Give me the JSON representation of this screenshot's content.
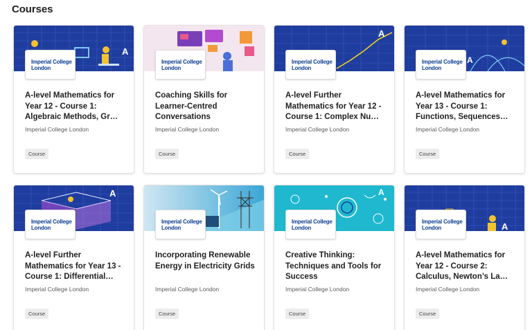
{
  "section": {
    "title": "Courses"
  },
  "courses": [
    {
      "title": "A-level Mathematics for Year 12 - Course 1: Algebraic Methods, Gr…",
      "partner": "Imperial College London",
      "logo": "Imperial College London",
      "badge": "Course",
      "thumb_theme": "maths-blue-desk"
    },
    {
      "title": "Coaching Skills for Learner-Centred Conversations",
      "partner": "Imperial College London",
      "logo": "Imperial College London",
      "badge": "Course",
      "thumb_theme": "coaching-pink-screens"
    },
    {
      "title": "A-level Further Mathematics for Year 12 - Course 1: Complex Nu…",
      "partner": "Imperial College London",
      "logo": "Imperial College London",
      "badge": "Course",
      "thumb_theme": "maths-blue-graph"
    },
    {
      "title": "A-level Mathematics for Year 13 - Course 1: Functions, Sequences…",
      "partner": "Imperial College London",
      "logo": "Imperial College London",
      "badge": "Course",
      "thumb_theme": "maths-blue-curves"
    },
    {
      "title": "A-level Further Mathematics for Year 13 - Course 1: Differential…",
      "partner": "Imperial College London",
      "logo": "Imperial College London",
      "badge": "Course",
      "thumb_theme": "maths-blue-cube"
    },
    {
      "title": "Incorporating Renewable Energy in Electricity Grids",
      "partner": "Imperial College London",
      "logo": "Imperial College London",
      "badge": "Course",
      "thumb_theme": "energy-wind-turbine"
    },
    {
      "title": "Creative Thinking: Techniques and Tools for Success",
      "partner": "Imperial College London",
      "logo": "Imperial College London",
      "badge": "Course",
      "thumb_theme": "creative-cyan-brain"
    },
    {
      "title": "A-level Mathematics for Year 12 - Course 2: Calculus, Newton’s La…",
      "partner": "Imperial College London",
      "logo": "Imperial College London",
      "badge": "Course",
      "thumb_theme": "maths-blue-desk"
    }
  ],
  "colors": {
    "maths_blue": "#1f3d9e",
    "coaching_bg": "#f4e6ee",
    "energy_bg": "#7fd0e8",
    "creative_bg": "#1fb8cf",
    "logo_navy": "#0b3d91"
  }
}
